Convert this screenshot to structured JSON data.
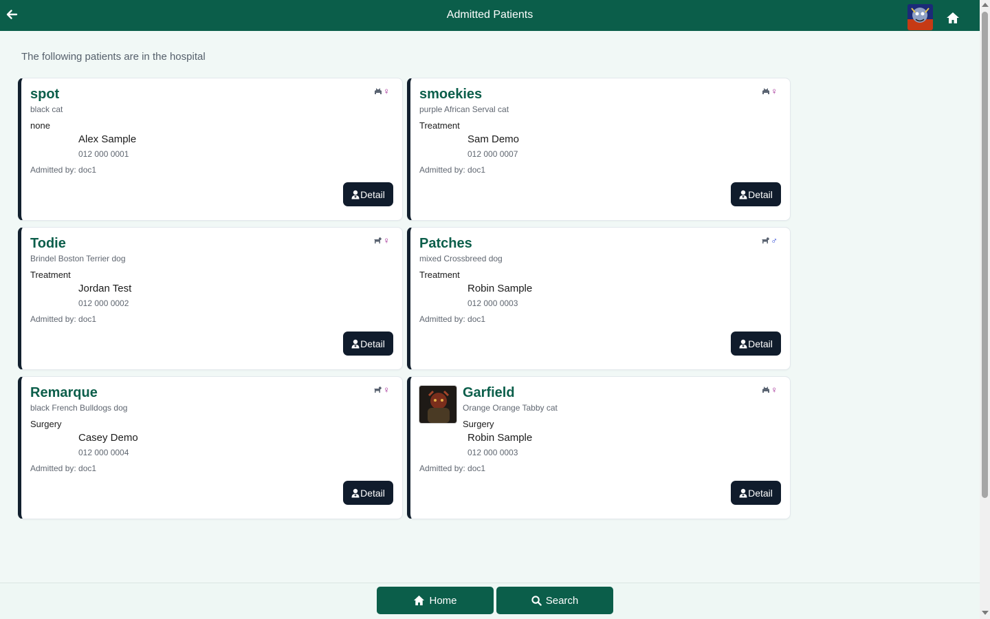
{
  "header": {
    "title": "Admitted Patients"
  },
  "page": {
    "subtitle": "The following patients are in the hospital"
  },
  "patients": [
    {
      "name": "spot",
      "breed": "black cat",
      "reason": "none",
      "owner": "Alex Sample",
      "phone": "012 000 0001",
      "admitted_label": "Admitted by:",
      "admitted_by": "doc1",
      "species": "cat",
      "gender": "female",
      "gender_symbol": "♀",
      "has_photo": false
    },
    {
      "name": "smoekies",
      "breed": "purple African Serval cat",
      "reason": "Treatment",
      "owner": "Sam Demo",
      "phone": "012 000 0007",
      "admitted_label": "Admitted by:",
      "admitted_by": "doc1",
      "species": "cat",
      "gender": "female",
      "gender_symbol": "♀",
      "has_photo": false
    },
    {
      "name": "Todie",
      "breed": "Brindel Boston Terrier dog",
      "reason": "Treatment",
      "owner": "Jordan Test",
      "phone": "012 000 0002",
      "admitted_label": "Admitted by:",
      "admitted_by": "doc1",
      "species": "dog",
      "gender": "female",
      "gender_symbol": "♀",
      "has_photo": false
    },
    {
      "name": "Patches",
      "breed": "mixed Crossbreed dog",
      "reason": "Treatment",
      "owner": "Robin Sample",
      "phone": "012 000 0003",
      "admitted_label": "Admitted by:",
      "admitted_by": "doc1",
      "species": "dog",
      "gender": "male",
      "gender_symbol": "♂",
      "has_photo": false
    },
    {
      "name": "Remarque",
      "breed": "black French Bulldogs dog",
      "reason": "Surgery",
      "owner": "Casey Demo",
      "phone": "012 000 0004",
      "admitted_label": "Admitted by:",
      "admitted_by": "doc1",
      "species": "dog",
      "gender": "female",
      "gender_symbol": "♀",
      "has_photo": false
    },
    {
      "name": "Garfield",
      "breed": "Orange Orange Tabby cat",
      "reason": "Surgery",
      "owner": "Robin Sample",
      "phone": "012 000 0003",
      "admitted_label": "Admitted by:",
      "admitted_by": "doc1",
      "species": "cat",
      "gender": "female",
      "gender_symbol": "♀",
      "has_photo": true
    }
  ],
  "card_button": {
    "detail_label": "Detail"
  },
  "bottom_nav": {
    "home_label": "Home",
    "search_label": "Search"
  },
  "colors": {
    "primary": "#0b5e4a",
    "dark": "#101c2c",
    "female": "#9b1c8c",
    "male": "#1f3bd1",
    "species": "#5b6472"
  },
  "icons": {
    "back": "arrow-left-icon",
    "home": "home-icon",
    "search": "search-icon",
    "detail": "user-doctor-icon",
    "cat": "cat-icon",
    "dog": "dog-icon"
  }
}
